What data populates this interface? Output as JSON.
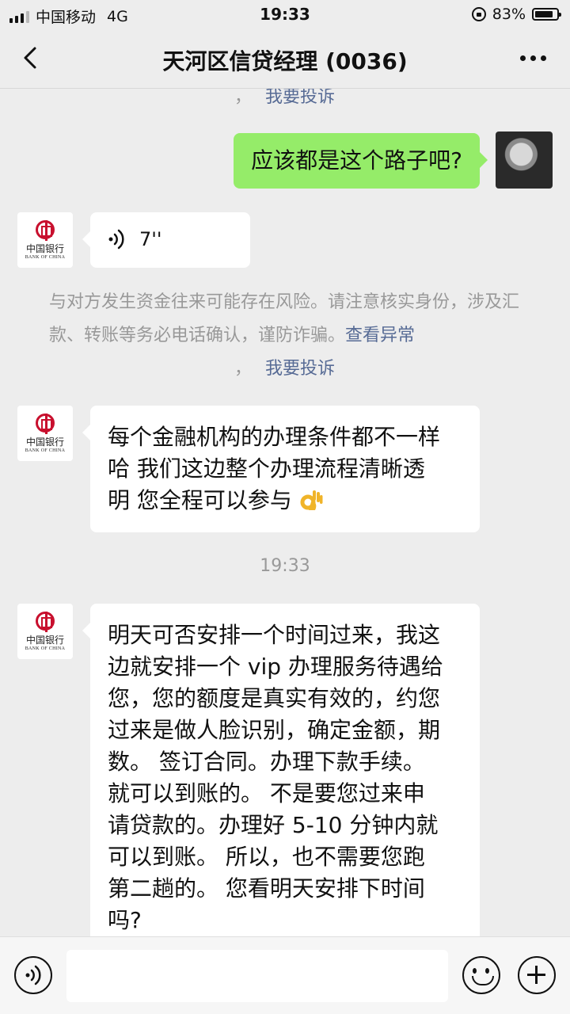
{
  "status_bar": {
    "carrier": "中国移动",
    "network": "4G",
    "time": "19:33",
    "battery": "83%",
    "battery_level": 0.83
  },
  "header": {
    "title": "天河区信贷经理 (0036)"
  },
  "messages": {
    "top_cut_link": "我要投诉",
    "top_cut_prefix": "，",
    "user_message": "应该都是这个路子吧?",
    "voice_duration": "7''",
    "warning_text": "与对方发生资金往来可能存在风险。请注意核实身份，涉及汇款、转账等务必电话确认，谨防诈骗。",
    "warning_link_1": "查看异常",
    "warning_sep": "，",
    "warning_link_2": "我要投诉",
    "msg1_line1": "每个金融机构的办理条件都不一样",
    "msg1_line2": "哈 我们这边整个办理流程清晰透",
    "msg1_line3": "明 您全程可以参与",
    "timestamp": "19:33",
    "msg2_lines": [
      "明天可否安排一个时间过来，我这",
      "边就安排一个 vip 办理服务待遇给",
      "您，您的额度是真实有效的，约您",
      "过来是做人脸识别，确定金额，期",
      "数。 签订合同。办理下款手续。",
      "就可以到账的。  不是要您过来申",
      "请贷款的。办理好 5-10 分钟内就",
      "可以到账。 所以，也不需要您跑",
      "第二趟的。  您看明天安排下时间",
      "吗?"
    ]
  },
  "avatar": {
    "bank_cn": "中国银行",
    "bank_en": "BANK OF CHINA"
  },
  "colors": {
    "background": "#ededed",
    "bubble_self": "#95ec69",
    "bubble_other": "#ffffff",
    "link": "#576b95",
    "bank_red": "#c8102e"
  }
}
